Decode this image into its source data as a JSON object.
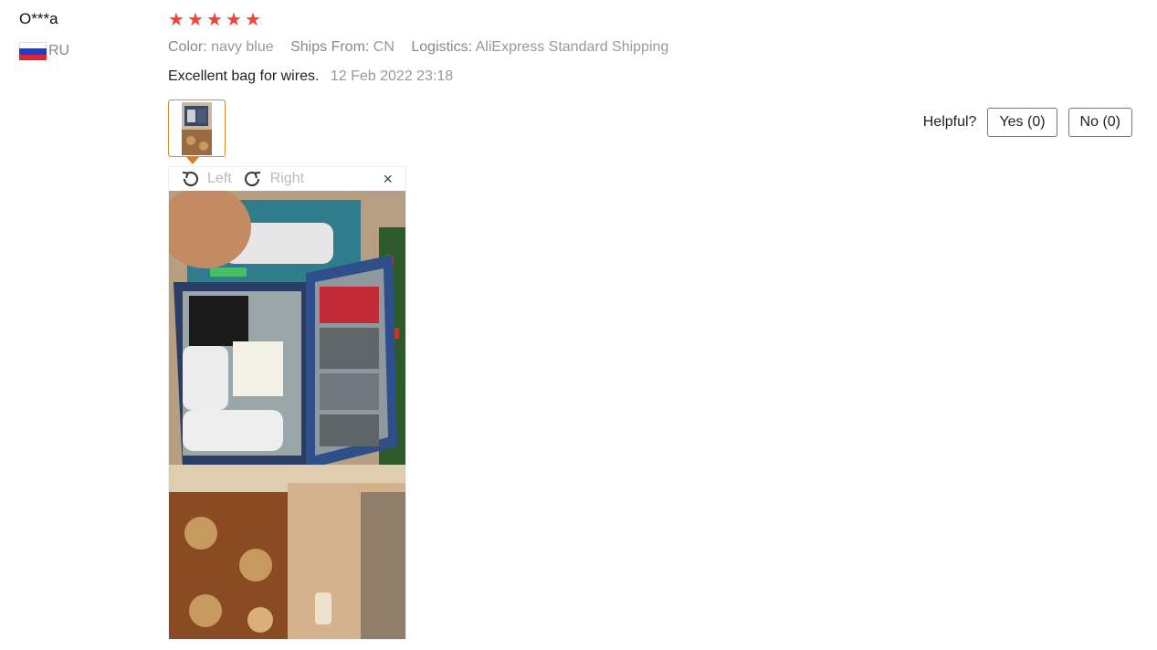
{
  "review": {
    "user": "O***a",
    "country": "RU",
    "rating": 5,
    "colors": {
      "star": "#f44336",
      "accent": "#e07a1f"
    },
    "meta": {
      "color_label": "Color:",
      "color_value": "navy blue",
      "ships_label": "Ships From:",
      "ships_value": "CN",
      "logistics_label": "Logistics:",
      "logistics_value": "AliExpress Standard Shipping"
    },
    "text": "Excellent bag for wires.",
    "date": "12 Feb 2022 23:18"
  },
  "helpful": {
    "label": "Helpful?",
    "yes": "Yes (0)",
    "no": "No (0)"
  },
  "viewer": {
    "rotate_left": "Left",
    "rotate_right": "Right",
    "close": "×",
    "icons": [
      "rotate-left-icon",
      "rotate-right-icon",
      "close-icon"
    ]
  }
}
